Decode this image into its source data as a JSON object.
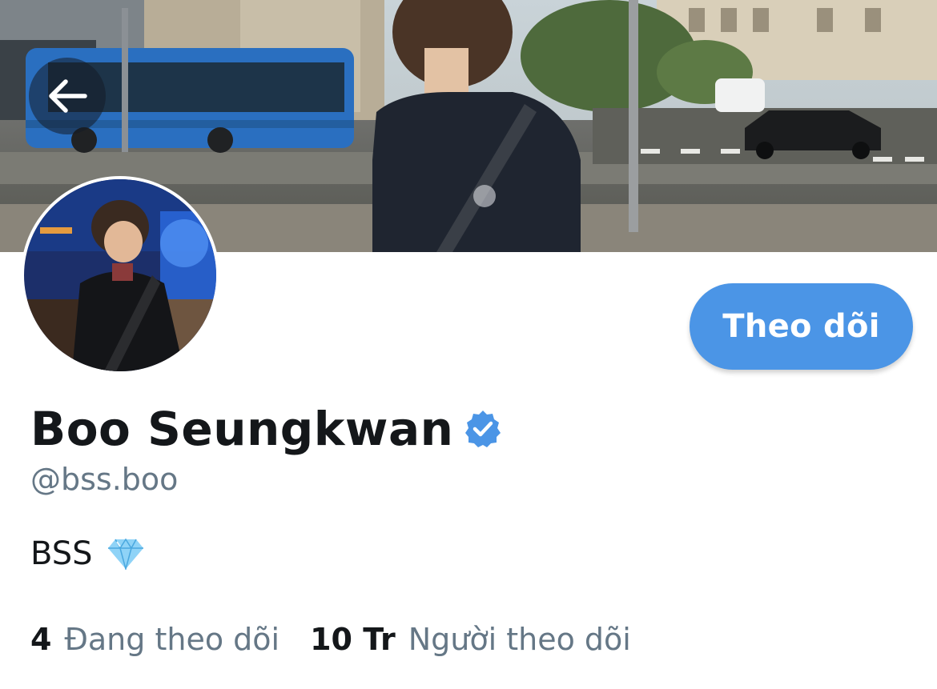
{
  "profile": {
    "display_name": "Boo Seungkwan",
    "handle": "@bss.boo",
    "verified": true,
    "bio_text": "BSS",
    "bio_emoji": "gem-stone-icon"
  },
  "actions": {
    "follow_label": "Theo dõi",
    "back_icon": "arrow-left-icon"
  },
  "stats": {
    "following_count": "4",
    "following_label": "Đang theo dõi",
    "followers_count": "10 Tr",
    "followers_label": "Người theo dõi"
  },
  "colors": {
    "accent": "#4b95e6",
    "verified": "#4b95e6",
    "secondary_text": "#657786",
    "primary_text": "#14171a"
  }
}
